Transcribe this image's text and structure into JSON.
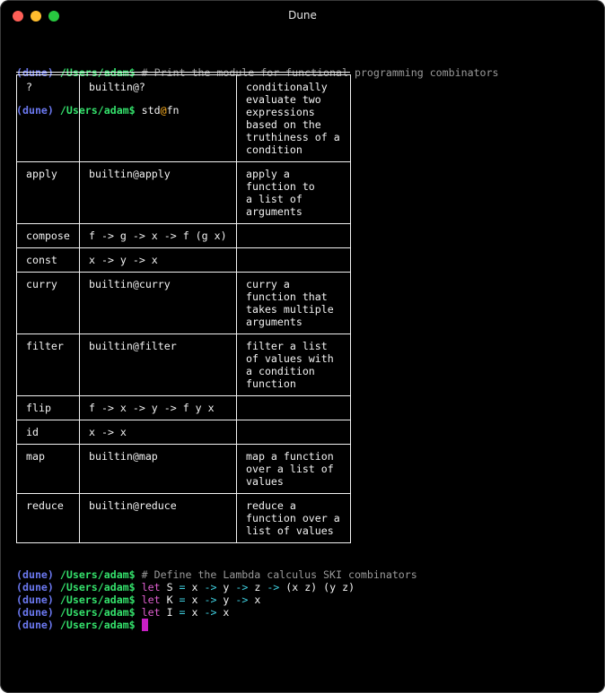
{
  "window": {
    "title": "Dune",
    "controls": [
      "close",
      "minimize",
      "maximize"
    ]
  },
  "prompt": {
    "env": "(dune)",
    "path": "/Users/adam$"
  },
  "session_top": [
    {
      "type": "comment",
      "text": "# Print the module for functional programming combinators"
    },
    {
      "type": "command",
      "parts": [
        {
          "text": "std",
          "style": "plain"
        },
        {
          "text": "@",
          "style": "at"
        },
        {
          "text": "fn",
          "style": "plain"
        }
      ]
    }
  ],
  "module_table": {
    "rows": [
      {
        "name": "?",
        "value": "builtin@?",
        "description": "conditionally\nevaluate two\nexpressions\nbased on the\ntruthiness of a\ncondition"
      },
      {
        "name": "apply",
        "value": "builtin@apply",
        "description": "apply a\nfunction to\na list of\narguments"
      },
      {
        "name": "compose",
        "value": "f -> g -> x -> f (g x)",
        "description": ""
      },
      {
        "name": "const",
        "value": "x -> y -> x",
        "description": ""
      },
      {
        "name": "curry",
        "value": "builtin@curry",
        "description": "curry a\nfunction that\ntakes multiple\narguments"
      },
      {
        "name": "filter",
        "value": "builtin@filter",
        "description": "filter a list\nof values with\na condition\nfunction"
      },
      {
        "name": "flip",
        "value": "f -> x -> y -> f y x",
        "description": ""
      },
      {
        "name": "id",
        "value": "x -> x",
        "description": ""
      },
      {
        "name": "map",
        "value": "builtin@map",
        "description": "map a function\nover a list of\nvalues"
      },
      {
        "name": "reduce",
        "value": "builtin@reduce",
        "description": "reduce a\nfunction over a\nlist of values"
      }
    ]
  },
  "session_bottom": {
    "comment": "# Define the Lambda calculus SKI combinators",
    "definitions": [
      {
        "kw": "let",
        "name": "S",
        "eq": "=",
        "body": [
          {
            "t": "x",
            "s": "plain"
          },
          {
            "t": "->",
            "s": "op"
          },
          {
            "t": "y",
            "s": "plain"
          },
          {
            "t": "->",
            "s": "op"
          },
          {
            "t": "z",
            "s": "plain"
          },
          {
            "t": "->",
            "s": "op"
          },
          {
            "t": "(x z) (y z)",
            "s": "plain"
          }
        ]
      },
      {
        "kw": "let",
        "name": "K",
        "eq": "=",
        "body": [
          {
            "t": "x",
            "s": "plain"
          },
          {
            "t": "->",
            "s": "op"
          },
          {
            "t": "y",
            "s": "plain"
          },
          {
            "t": "->",
            "s": "op"
          },
          {
            "t": "x",
            "s": "plain"
          }
        ]
      },
      {
        "kw": "let",
        "name": "I",
        "eq": "=",
        "body": [
          {
            "t": "x",
            "s": "plain"
          },
          {
            "t": "->",
            "s": "op"
          },
          {
            "t": "x",
            "s": "plain"
          }
        ]
      }
    ],
    "current_input": ""
  },
  "colors": {
    "prompt_env": "#6b78f0",
    "prompt_path": "#34e06b",
    "comment": "#9a9a9a",
    "keyword": "#e05fd0",
    "operator": "#3fd0e0",
    "at_sign": "#ffb020",
    "cursor": "#c81fc4",
    "background": "#000000",
    "foreground": "#f2f2f2"
  }
}
